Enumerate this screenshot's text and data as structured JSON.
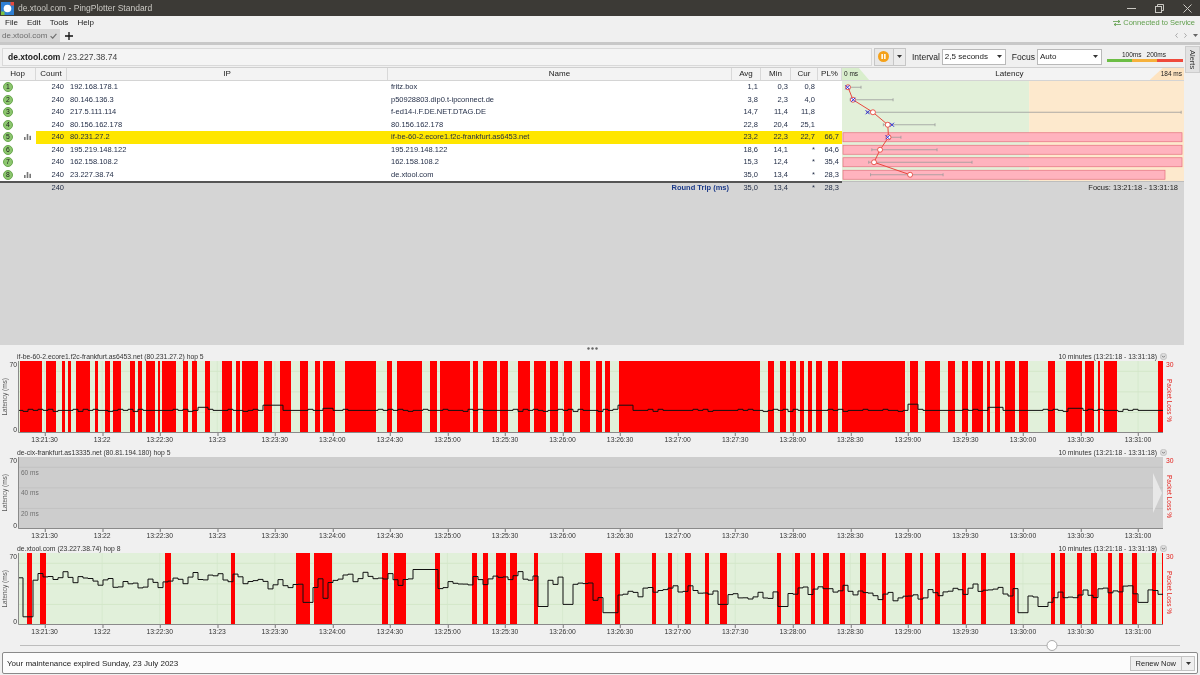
{
  "window": {
    "title": "de.xtool.com - PingPlotter Standard"
  },
  "menu": [
    "File",
    "Edit",
    "Tools",
    "Help"
  ],
  "connection_status": "Connected to Service",
  "tabs": [
    {
      "label": "de.xtool.com",
      "selected": true
    }
  ],
  "toolbar": {
    "target": "**de.xtool.com** / 23.227.38.74",
    "interval_label": "Interval",
    "interval": "2,5 seconds",
    "focus_label": "Focus",
    "focus": "Auto",
    "scale_labels": [
      "100ms",
      "200ms"
    ]
  },
  "alerts_tab": "Alerts",
  "table": {
    "columns": [
      "Hop",
      "Count",
      "IP",
      "Name",
      "Avg",
      "Min",
      "Cur",
      "PL%"
    ],
    "latency_header": {
      "min": "0 ms",
      "title": "Latency",
      "max": "184 ms"
    },
    "rows": [
      {
        "hop": "1",
        "count": "240",
        "ip": "192.168.178.1",
        "name": "fritz.box",
        "avg": "1,1",
        "min": "0,3",
        "cur": "0,8",
        "selected": false,
        "graphed": false
      },
      {
        "hop": "2",
        "count": "240",
        "ip": "80.146.136.3",
        "name": "p50928803.dip0.t-ipconnect.de",
        "avg": "3,8",
        "min": "2,3",
        "cur": "4,0",
        "selected": false,
        "graphed": false
      },
      {
        "hop": "3",
        "count": "240",
        "ip": "217.5.111.114",
        "name": "f-ed14-i.F.DE.NET.DTAG.DE",
        "avg": "14,7",
        "min": "11,4",
        "cur": "11,8",
        "selected": false,
        "graphed": false
      },
      {
        "hop": "4",
        "count": "240",
        "ip": "80.156.162.178",
        "name": "80.156.162.178",
        "avg": "22,8",
        "min": "20,4",
        "cur": "25,1",
        "selected": false,
        "graphed": false
      },
      {
        "hop": "5",
        "count": "240",
        "ip": "80.231.27.2",
        "name": "if-be-60-2.ecore1.f2c-frankfurt.as6453.net",
        "avg": "23,2",
        "min": "22,3",
        "cur": "22,7",
        "pl": "66,7",
        "selected": true,
        "graphed": true
      },
      {
        "hop": "6",
        "count": "240",
        "ip": "195.219.148.122",
        "name": "195.219.148.122",
        "avg": "18,6",
        "min": "14,1",
        "cur": "*",
        "pl": "64,6",
        "selected": false,
        "graphed": false
      },
      {
        "hop": "7",
        "count": "240",
        "ip": "162.158.108.2",
        "name": "162.158.108.2",
        "avg": "15,3",
        "min": "12,4",
        "cur": "*",
        "pl": "35,4",
        "selected": false,
        "graphed": false
      },
      {
        "hop": "8",
        "count": "240",
        "ip": "23.227.38.74",
        "name": "de.xtool.com",
        "avg": "35,0",
        "min": "13,4",
        "cur": "*",
        "pl": "28,3",
        "selected": false,
        "graphed": true
      }
    ],
    "summary": {
      "count": "240",
      "label": "Round Trip (ms)",
      "avg": "35,0",
      "min": "13,4",
      "cur": "*",
      "pl": "28,3"
    },
    "focus": "Focus: 13:21:18 - 13:31:18"
  },
  "timeline_graphs": [
    {
      "title": "if-be-60-2.ecore1.f2c-frankfurt.as6453.net (80.231.27.2) hop 5",
      "range": "10 minutes (13:21:18 - 13:31:18)",
      "has_data": true,
      "y_label": "Latency (ms)",
      "y_max": "70",
      "y_min": "0",
      "loss_label": "Packet Loss %",
      "loss_max": "30",
      "time_labels": [
        "13:21:30",
        "13:22",
        "13:22:30",
        "13:23",
        "13:23:30",
        "13:24:00",
        "13:24:30",
        "13:25:00",
        "13:25:30",
        "13:26:00",
        "13:26:30",
        "13:27:00",
        "13:27:30",
        "13:28:00",
        "13:28:30",
        "13:29:00",
        "13:29:30",
        "13:30:00",
        "13:30:30",
        "13:31:00"
      ]
    },
    {
      "title": "de-cix-frankfurt.as13335.net (80.81.194.180) hop 5",
      "range": "10 minutes (13:21:18 - 13:31:18)",
      "has_data": false,
      "y_label": "Latency (ms)",
      "y_max": "70",
      "y_min": "0",
      "grid_labels": [
        "60 ms",
        "40 ms",
        "20 ms"
      ],
      "loss_label": "Packet Loss %",
      "loss_max": "30",
      "time_labels": [
        "13:21:30",
        "13:22",
        "13:22:30",
        "13:23",
        "13:23:30",
        "13:24:00",
        "13:24:30",
        "13:25:00",
        "13:25:30",
        "13:26:00",
        "13:26:30",
        "13:27:00",
        "13:27:30",
        "13:28:00",
        "13:28:30",
        "13:29:00",
        "13:29:30",
        "13:30:00",
        "13:30:30",
        "13:31:00"
      ]
    },
    {
      "title": "de.xtool.com (23.227.38.74) hop 8",
      "range": "10 minutes (13:21:18 - 13:31:18)",
      "has_data": true,
      "y_label": "Latency (ms)",
      "y_max": "70",
      "y_min": "0",
      "loss_label": "Packet Loss %",
      "loss_max": "30",
      "time_labels": [
        "13:21:30",
        "13:22",
        "13:22:30",
        "13:23",
        "13:23:30",
        "13:24:00",
        "13:24:30",
        "13:25:00",
        "13:25:30",
        "13:26:00",
        "13:26:30",
        "13:27:00",
        "13:27:30",
        "13:28:00",
        "13:28:30",
        "13:29:00",
        "13:29:30",
        "13:30:00",
        "13:30:30",
        "13:31:00"
      ]
    }
  ],
  "slider": {
    "level": 0.89
  },
  "status_bar": {
    "message": "Your maintenance expired Sunday, 23 July 2023",
    "button": "Renew Now"
  }
}
